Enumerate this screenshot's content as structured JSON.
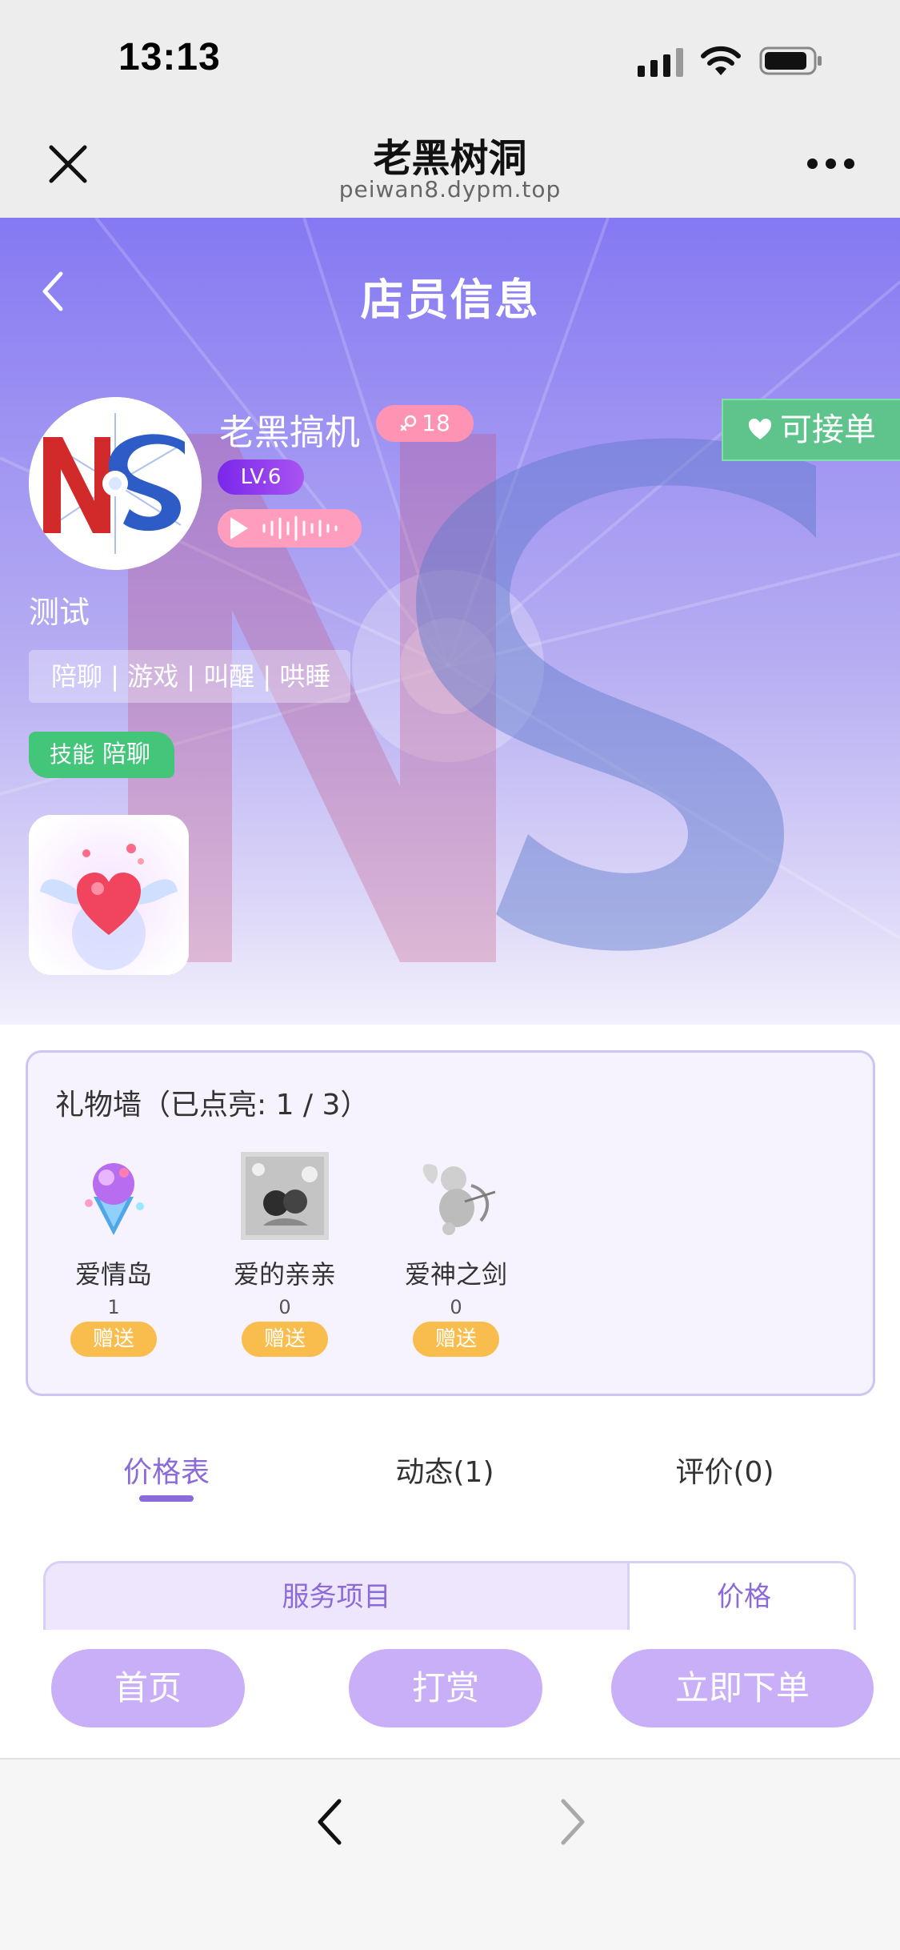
{
  "status_bar": {
    "time": "13:13",
    "icons": [
      "signal-icon",
      "wifi-icon",
      "battery-icon"
    ]
  },
  "nav": {
    "title": "老黑树洞",
    "url": "peiwan8.dypm.top",
    "close_icon": "close-icon",
    "more_icon": "more-icon"
  },
  "hero": {
    "page_title": "店员信息",
    "back_icon": "chevron-left-icon",
    "nickname": "老黑搞机",
    "age": "18",
    "level": "LV.6",
    "status_button": "可接单",
    "signature": "测试",
    "tags": "陪聊 | 游戏 | 叫醒 | 哄睡",
    "skill_label": "技能",
    "skill_value": "陪聊",
    "avatar_logo": "NS"
  },
  "gift_wall": {
    "title": "礼物墙（已点亮: 1 / 3）",
    "gifts": [
      {
        "name": "爱情岛",
        "count": "1",
        "send_label": "赠送"
      },
      {
        "name": "爱的亲亲",
        "count": "0",
        "send_label": "赠送"
      },
      {
        "name": "爱神之剑",
        "count": "0",
        "send_label": "赠送"
      }
    ]
  },
  "tabs": [
    {
      "label": "价格表",
      "active": true
    },
    {
      "label": "动态(1)",
      "active": false
    },
    {
      "label": "评价(0)",
      "active": false
    }
  ],
  "price_table": {
    "col_service": "服务项目",
    "col_price": "价格"
  },
  "actions": {
    "home": "首页",
    "tip": "打赏",
    "order": "立即下单"
  },
  "browser": {
    "back_icon": "chevron-left-icon",
    "forward_icon": "chevron-right-icon"
  },
  "colors": {
    "accent": "#8c6ad9",
    "hero_top": "#8479f2",
    "available_green": "#5ec48b",
    "skill_green": "#43c57a",
    "action_button": "#c9aff7",
    "send_button": "#f9bd4e",
    "age_badge": "#ff93b4"
  }
}
